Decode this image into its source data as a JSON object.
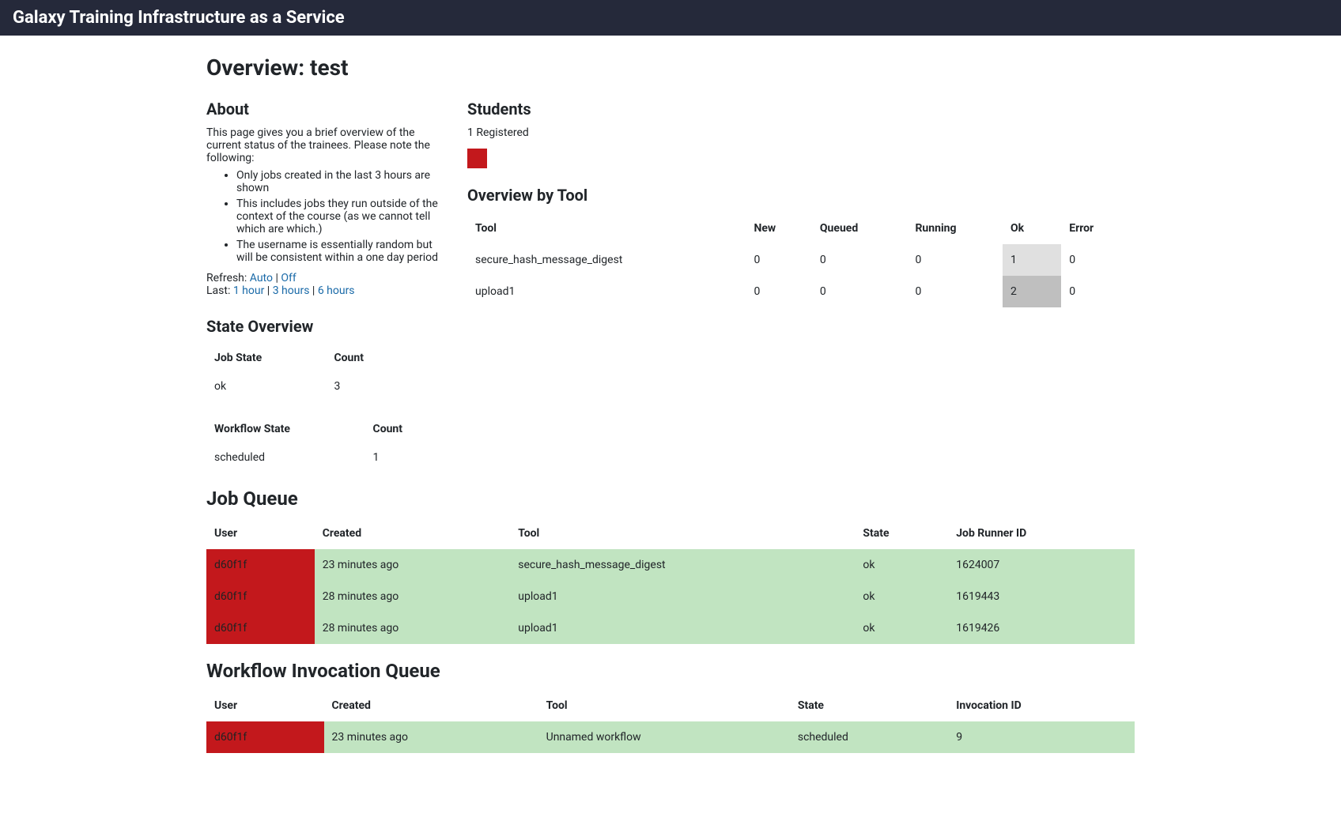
{
  "header": {
    "title": "Galaxy Training Infrastructure as a Service"
  },
  "page": {
    "title": "Overview: test"
  },
  "about": {
    "heading": "About",
    "intro": "This page gives you a brief overview of the current status of the trainees. Please note the following:",
    "bullets": [
      "Only jobs created in the last 3 hours are shown",
      "This includes jobs they run outside of the context of the course (as we cannot tell which are which.)",
      "The username is essentially random but will be consistent within a one day period"
    ],
    "refresh_label": "Refresh: ",
    "refresh_auto": "Auto",
    "refresh_off": "Off",
    "last_label": "Last: ",
    "last_1h": "1 hour",
    "last_3h": "3 hours",
    "last_6h": "6 hours",
    "pipe": " | "
  },
  "students": {
    "heading": "Students",
    "registered": "1 Registered"
  },
  "overview_by_tool": {
    "heading": "Overview by Tool",
    "cols": {
      "tool": "Tool",
      "new": "New",
      "queued": "Queued",
      "running": "Running",
      "ok": "Ok",
      "error": "Error"
    },
    "rows": [
      {
        "tool": "secure_hash_message_digest",
        "new": "0",
        "queued": "0",
        "running": "0",
        "ok": "1",
        "error": "0"
      },
      {
        "tool": "upload1",
        "new": "0",
        "queued": "0",
        "running": "0",
        "ok": "2",
        "error": "0"
      }
    ]
  },
  "state_overview": {
    "heading": "State Overview",
    "job_cols": {
      "state": "Job State",
      "count": "Count"
    },
    "job_rows": [
      {
        "state": "ok",
        "count": "3"
      }
    ],
    "wf_cols": {
      "state": "Workflow State",
      "count": "Count"
    },
    "wf_rows": [
      {
        "state": "scheduled",
        "count": "1"
      }
    ]
  },
  "job_queue": {
    "heading": "Job Queue",
    "cols": {
      "user": "User",
      "created": "Created",
      "tool": "Tool",
      "state": "State",
      "runner": "Job Runner ID"
    },
    "rows": [
      {
        "user": "d60f1f",
        "created": "23 minutes ago",
        "tool": "secure_hash_message_digest",
        "state": "ok",
        "runner": "1624007"
      },
      {
        "user": "d60f1f",
        "created": "28 minutes ago",
        "tool": "upload1",
        "state": "ok",
        "runner": "1619443"
      },
      {
        "user": "d60f1f",
        "created": "28 minutes ago",
        "tool": "upload1",
        "state": "ok",
        "runner": "1619426"
      }
    ]
  },
  "wf_queue": {
    "heading": "Workflow Invocation Queue",
    "cols": {
      "user": "User",
      "created": "Created",
      "tool": "Tool",
      "state": "State",
      "inv": "Invocation ID"
    },
    "rows": [
      {
        "user": "d60f1f",
        "created": "23 minutes ago",
        "tool": "Unnamed workflow",
        "state": "scheduled",
        "inv": "9"
      }
    ]
  }
}
